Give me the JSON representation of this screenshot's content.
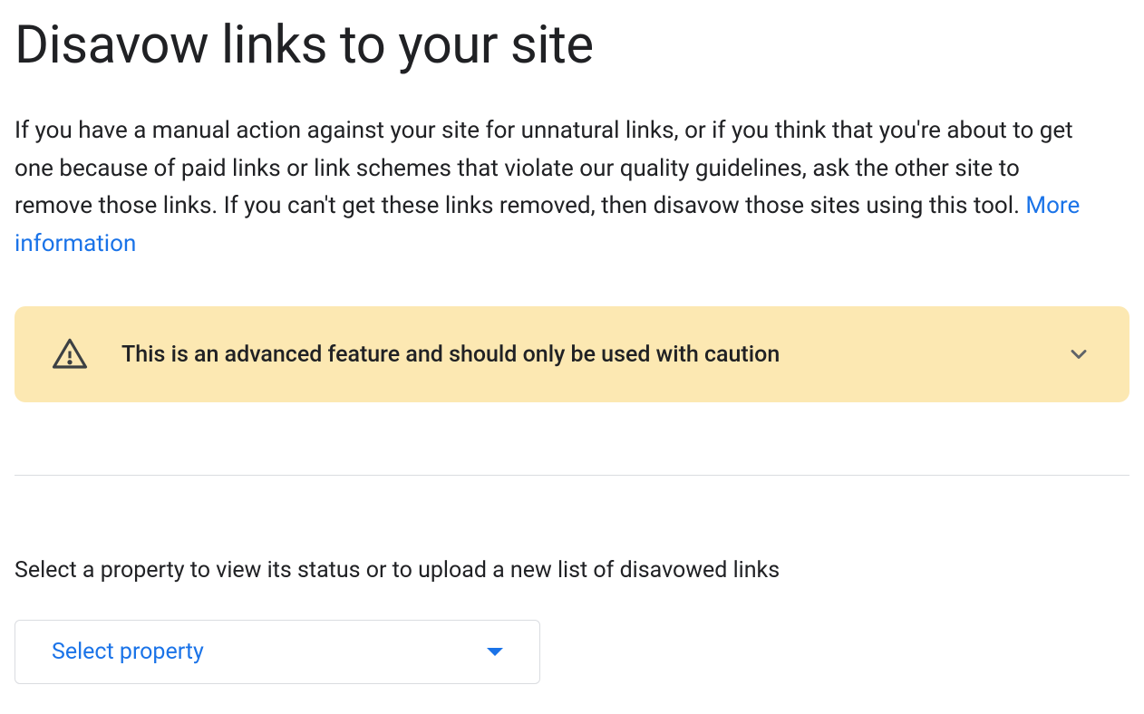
{
  "page": {
    "title": "Disavow links to your site",
    "description_text": "If you have a manual action against your site for unnatural links, or if you think that you're about to get one because of paid links or link schemes that violate our quality guidelines, ask the other site to remove those links. If you can't get these links removed, then disavow those sites using this tool. ",
    "more_info_link": "More information"
  },
  "warning": {
    "text": "This is an advanced feature and should only be used with caution"
  },
  "property_section": {
    "label": "Select a property to view its status or to upload a new list of disavowed links",
    "dropdown_label": "Select property"
  }
}
